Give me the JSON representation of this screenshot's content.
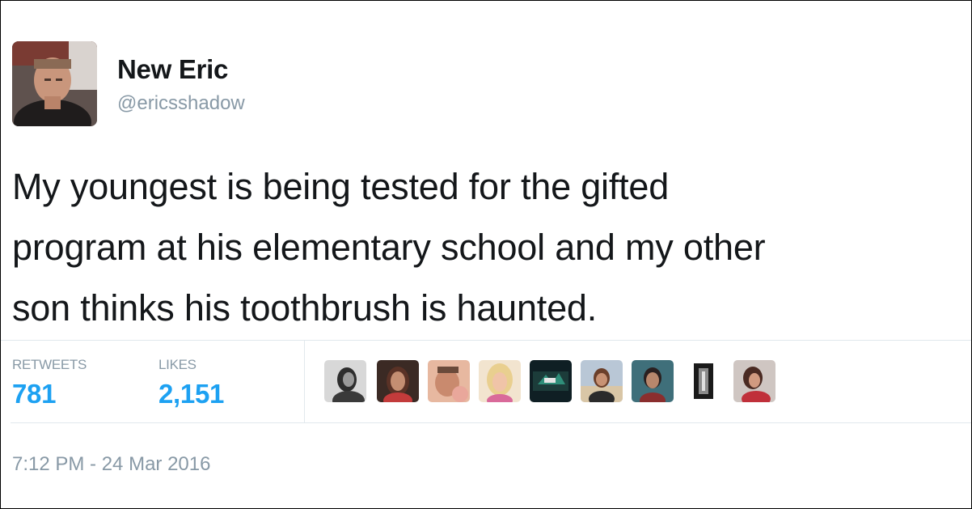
{
  "tweet": {
    "author": {
      "display_name": "New Eric",
      "handle": "@ericsshadow",
      "avatar_icon": "profile-photo"
    },
    "text_lines": [
      "My youngest is being tested for the gifted",
      "program at his elementary school and my other",
      "son thinks his toothbrush is haunted."
    ],
    "stats": {
      "retweets_label": "RETWEETS",
      "retweets_count": "781",
      "likes_label": "LIKES",
      "likes_count": "2,151"
    },
    "timestamp": "7:12 PM - 24 Mar 2016"
  },
  "colors": {
    "text": "#14171a",
    "muted": "#8899a6",
    "accent": "#1da1f2",
    "divider": "#e1e8ed"
  }
}
